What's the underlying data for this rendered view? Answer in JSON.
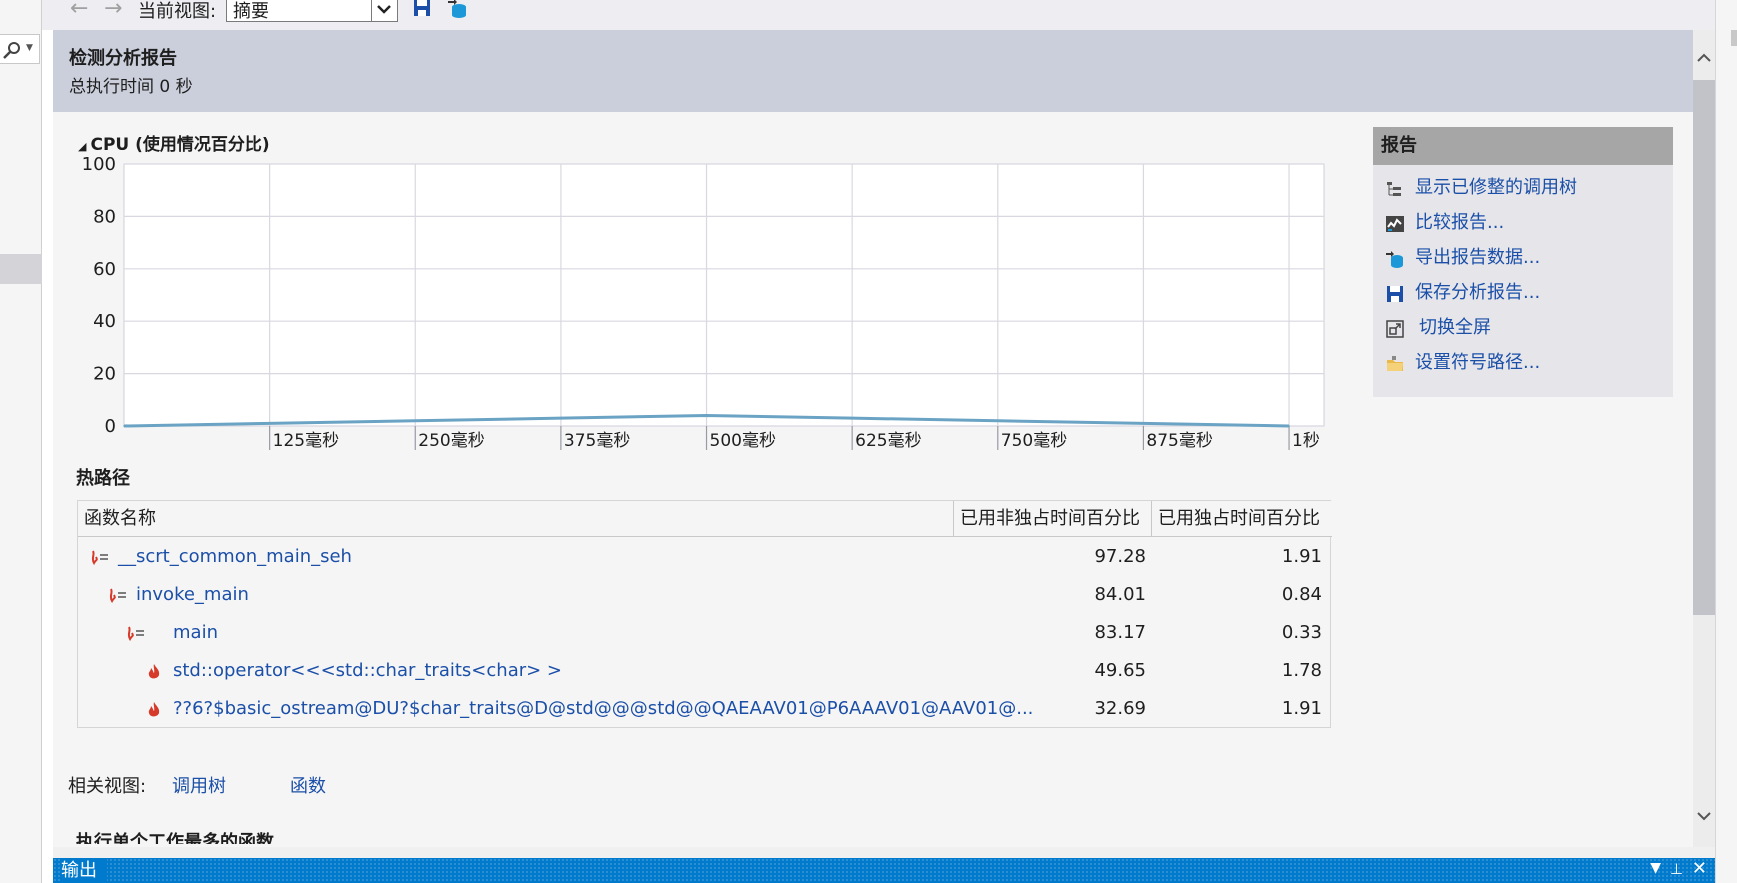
{
  "toolbar": {
    "view_label": "当前视图:",
    "view_value": "摘要"
  },
  "header": {
    "title": "检测分析报告",
    "subtitle": "总执行时间 0 秒"
  },
  "cpu": {
    "title": "CPU (使用情况百分比)"
  },
  "chart_data": {
    "type": "area",
    "title": "CPU (使用情况百分比)",
    "x": [
      0,
      125,
      250,
      375,
      500,
      625,
      750,
      875,
      1000
    ],
    "series": [
      {
        "values": [
          0,
          1,
          2,
          3,
          4,
          3,
          2,
          1,
          0
        ]
      }
    ],
    "y_ticks": [
      "100",
      "80",
      "60",
      "40",
      "20",
      "0"
    ],
    "x_ticks": [
      "125毫秒",
      "250毫秒",
      "375毫秒",
      "500毫秒",
      "625毫秒",
      "750毫秒",
      "875毫秒",
      "1秒"
    ],
    "xlim": [
      0,
      1030
    ],
    "ylim": [
      0,
      100
    ],
    "grid": true,
    "line_color": "#6ba3c4"
  },
  "hot_path": {
    "title": "热路径",
    "columns": [
      "函数名称",
      "已用非独占时间百分比",
      "已用独占时间百分比"
    ],
    "rows": [
      {
        "name": "__scrt_common_main_seh",
        "incl": "97.28",
        "excl": "1.91"
      },
      {
        "name": "invoke_main",
        "incl": "84.01",
        "excl": "0.84"
      },
      {
        "name": "main",
        "incl": "83.17",
        "excl": "0.33"
      },
      {
        "name": "std::operator<<<std::char_traits<char> >",
        "incl": "49.65",
        "excl": "1.78"
      },
      {
        "name": "??6?$basic_ostream@DU?$char_traits@D@std@@@std@@QAEAAV01@P6AAAV01@AAV01@...",
        "incl": "32.69",
        "excl": "1.91"
      }
    ]
  },
  "related": {
    "label": "相关视图:",
    "call_tree": "调用树",
    "functions": "函数"
  },
  "cut_heading": "执行单个工作最多的函数",
  "reports": {
    "title": "报告",
    "links": [
      {
        "label": "显示已修整的调用树",
        "icon": "call-tree-icon"
      },
      {
        "label": "比较报告...",
        "icon": "compare-icon"
      },
      {
        "label": "导出报告数据...",
        "icon": "export-icon"
      },
      {
        "label": "保存分析报告...",
        "icon": "save-icon"
      },
      {
        "label": "切换全屏",
        "icon": "fullscreen-icon"
      },
      {
        "label": "设置符号路径...",
        "icon": "folder-icon"
      }
    ]
  },
  "output": {
    "title": "输出"
  },
  "colors": {
    "header_bg": "#cbcfdb",
    "link": "#1b4fa8",
    "flame": "#d63a2a",
    "output_bar": "#007acc"
  }
}
